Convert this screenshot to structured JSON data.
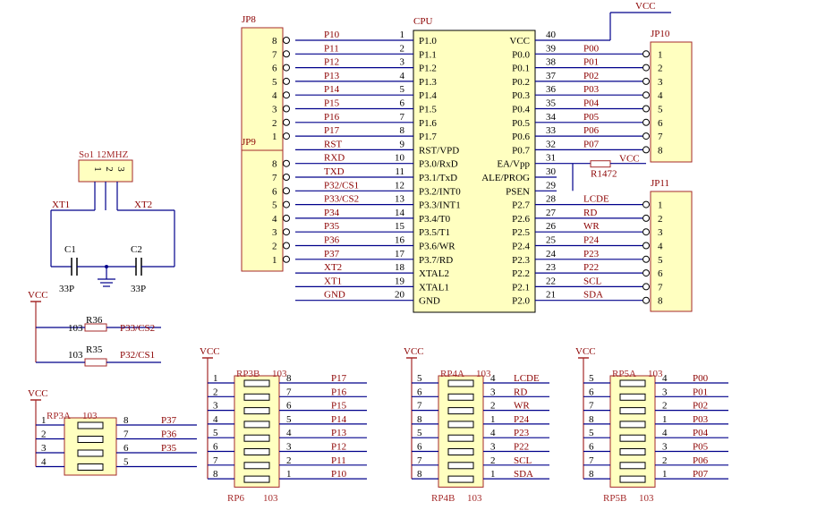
{
  "colors": {
    "wire": "#00008B",
    "label": "#8B0000",
    "pin": "#000000",
    "part": "#A52A2A",
    "fill": "#FFFFC0"
  },
  "cpu": {
    "title": "CPU",
    "left_pins": [
      {
        "num": "1",
        "name": "P1.0",
        "net": "P10"
      },
      {
        "num": "2",
        "name": "P1.1",
        "net": "P11"
      },
      {
        "num": "3",
        "name": "P1.2",
        "net": "P12"
      },
      {
        "num": "4",
        "name": "P1.3",
        "net": "P13"
      },
      {
        "num": "5",
        "name": "P1.4",
        "net": "P14"
      },
      {
        "num": "6",
        "name": "P1.5",
        "net": "P15"
      },
      {
        "num": "7",
        "name": "P1.6",
        "net": "P16"
      },
      {
        "num": "8",
        "name": "P1.7",
        "net": "P17"
      },
      {
        "num": "9",
        "name": "RST/VPD",
        "net": "RST"
      },
      {
        "num": "10",
        "name": "P3.0/RxD",
        "net": "RXD"
      },
      {
        "num": "11",
        "name": "P3.1/TxD",
        "net": "TXD"
      },
      {
        "num": "12",
        "name": "P3.2/INT0",
        "net": "P32/CS1"
      },
      {
        "num": "13",
        "name": "P3.3/INT1",
        "net": "P33/CS2"
      },
      {
        "num": "14",
        "name": "P3.4/T0",
        "net": "P34"
      },
      {
        "num": "15",
        "name": "P3.5/T1",
        "net": "P35"
      },
      {
        "num": "16",
        "name": "P3.6/WR",
        "net": "P36"
      },
      {
        "num": "17",
        "name": "P3.7/RD",
        "net": "P37"
      },
      {
        "num": "18",
        "name": "XTAL2",
        "net": "XT2"
      },
      {
        "num": "19",
        "name": "XTAL1",
        "net": "XT1"
      },
      {
        "num": "20",
        "name": "GND",
        "net": "GND"
      }
    ],
    "right_pins": [
      {
        "num": "40",
        "name": "VCC",
        "net": ""
      },
      {
        "num": "39",
        "name": "P0.0",
        "net": "P00"
      },
      {
        "num": "38",
        "name": "P0.1",
        "net": "P01"
      },
      {
        "num": "37",
        "name": "P0.2",
        "net": "P02"
      },
      {
        "num": "36",
        "name": "P0.3",
        "net": "P03"
      },
      {
        "num": "35",
        "name": "P0.4",
        "net": "P04"
      },
      {
        "num": "34",
        "name": "P0.5",
        "net": "P05"
      },
      {
        "num": "33",
        "name": "P0.6",
        "net": "P06"
      },
      {
        "num": "32",
        "name": "P0.7",
        "net": "P07"
      },
      {
        "num": "31",
        "name": "EA/Vpp",
        "net": "VCC"
      },
      {
        "num": "30",
        "name": "ALE/PROG",
        "net": ""
      },
      {
        "num": "29",
        "name": "PSEN",
        "net": ""
      },
      {
        "num": "28",
        "name": "P2.7",
        "net": "LCDE"
      },
      {
        "num": "27",
        "name": "P2.6",
        "net": "RD"
      },
      {
        "num": "26",
        "name": "P2.5",
        "net": "WR"
      },
      {
        "num": "25",
        "name": "P2.4",
        "net": "P24"
      },
      {
        "num": "24",
        "name": "P2.3",
        "net": "P23"
      },
      {
        "num": "23",
        "name": "P2.2",
        "net": "P22"
      },
      {
        "num": "22",
        "name": "P2.1",
        "net": "SCL"
      },
      {
        "num": "21",
        "name": "P2.0",
        "net": "SDA"
      }
    ],
    "vcc_label": "VCC"
  },
  "r1": {
    "ref": "R1",
    "value": "472"
  },
  "jp8": {
    "title": "JP8",
    "pins": [
      "8",
      "7",
      "6",
      "5",
      "4",
      "3",
      "2",
      "1"
    ]
  },
  "jp9": {
    "title": "JP9",
    "pins": [
      "8",
      "7",
      "6",
      "5",
      "4",
      "3",
      "2",
      "1"
    ]
  },
  "jp10": {
    "title": "JP10",
    "pins": [
      "1",
      "2",
      "3",
      "4",
      "5",
      "6",
      "7",
      "8"
    ]
  },
  "jp11": {
    "title": "JP11",
    "pins": [
      "1",
      "2",
      "3",
      "4",
      "5",
      "6",
      "7",
      "8"
    ]
  },
  "crystal": {
    "title": "So1 12MHZ",
    "pins": [
      "1",
      "2",
      "3"
    ],
    "xt1": "XT1",
    "xt2": "XT2",
    "c1": "C1",
    "c2": "C2",
    "c1_val": "33P",
    "c2_val": "33P"
  },
  "pullups": {
    "vcc": "VCC",
    "r36": {
      "val": "103",
      "ref": "R36",
      "net": "P33/CS2"
    },
    "r35": {
      "val": "103",
      "ref": "R35",
      "net": "P32/CS1"
    }
  },
  "rp3a": {
    "vcc": "VCC",
    "ref": "RP3A",
    "value": "103",
    "left": [
      "1",
      "2",
      "3",
      "4"
    ],
    "right": [
      "8",
      "7",
      "6",
      "5"
    ],
    "nets": [
      "P37",
      "P36",
      "P35",
      ""
    ]
  },
  "rp3b6": {
    "vcc": "VCC",
    "top_ref": "RP3B",
    "top_value": "103",
    "bottom_ref": "RP6",
    "bottom_value": "103",
    "left": [
      "1",
      "2",
      "3",
      "4",
      "5",
      "6",
      "7",
      "8"
    ],
    "right": [
      "8",
      "7",
      "6",
      "5",
      "4",
      "3",
      "2",
      "1"
    ],
    "nets": [
      "P17",
      "P16",
      "P15",
      "P14",
      "P13",
      "P12",
      "P11",
      "P10"
    ]
  },
  "rp4": {
    "vcc": "VCC",
    "top_ref": "RP4A",
    "top_value": "103",
    "bottom_ref": "RP4B",
    "bottom_value": "103",
    "left": [
      "5",
      "6",
      "7",
      "8",
      "5",
      "6",
      "7",
      "8"
    ],
    "right": [
      "4",
      "3",
      "2",
      "1",
      "4",
      "3",
      "2",
      "1"
    ],
    "nets": [
      "LCDE",
      "RD",
      "WR",
      "P24",
      "P23",
      "P22",
      "SCL",
      "SDA"
    ]
  },
  "rp5": {
    "vcc": "VCC",
    "top_ref": "RP5A",
    "top_value": "103",
    "bottom_ref": "RP5B",
    "bottom_value": "103",
    "left": [
      "5",
      "6",
      "7",
      "8",
      "5",
      "6",
      "7",
      "8"
    ],
    "right": [
      "4",
      "3",
      "2",
      "1",
      "4",
      "3",
      "2",
      "1"
    ],
    "nets": [
      "P00",
      "P01",
      "P02",
      "P03",
      "P04",
      "P05",
      "P06",
      "P07"
    ]
  }
}
